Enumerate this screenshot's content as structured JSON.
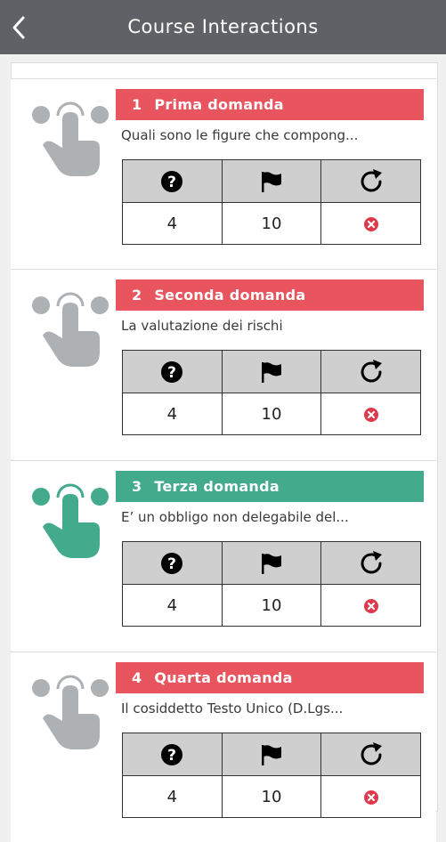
{
  "header": {
    "title": "Course Interactions",
    "back_icon": "chevron-left-icon"
  },
  "colors": {
    "header_bg": "#606166",
    "incorrect": "#e8555f",
    "correct": "#43aa8b",
    "hand_neutral": "#aeb1b3",
    "status_x": "#e0394b"
  },
  "questions": [
    {
      "number": "1",
      "title": "Prima domanda",
      "description": "Quali sono le figure che compong...",
      "attempts": "4",
      "points": "10",
      "status": "incorrect"
    },
    {
      "number": "2",
      "title": "Seconda domanda",
      "description": "La valutazione dei rischi",
      "attempts": "4",
      "points": "10",
      "status": "incorrect"
    },
    {
      "number": "3",
      "title": "Terza domanda",
      "description": "E’ un obbligo non delegabile del...",
      "attempts": "4",
      "points": "10",
      "status": "incorrect"
    },
    {
      "number": "4",
      "title": "Quarta domanda",
      "description": "Il cosiddetto Testo Unico (D.Lgs...",
      "attempts": "4",
      "points": "10",
      "status": "incorrect"
    }
  ],
  "table_header_icons": [
    "question-circle-icon",
    "flag-icon",
    "retry-icon"
  ]
}
